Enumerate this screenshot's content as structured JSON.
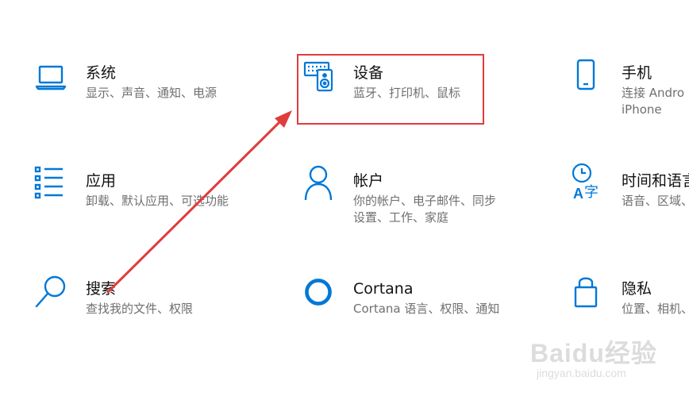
{
  "tiles": [
    {
      "title": "系统",
      "desc": "显示、声音、通知、电源",
      "icon": "laptop-icon"
    },
    {
      "title": "设备",
      "desc": "蓝牙、打印机、鼠标",
      "icon": "devices-icon"
    },
    {
      "title": "手机",
      "desc_line1": "连接 Andro",
      "desc_line2": "iPhone",
      "icon": "phone-icon"
    },
    {
      "title": "应用",
      "desc": "卸载、默认应用、可选功能",
      "icon": "apps-list-icon"
    },
    {
      "title": "帐户",
      "desc_line1": "你的帐户、电子邮件、同步",
      "desc_line2": "设置、工作、家庭",
      "icon": "person-icon"
    },
    {
      "title": "时间和语言",
      "desc": "语音、区域、",
      "icon": "time-language-icon"
    },
    {
      "title": "搜索",
      "desc": "查找我的文件、权限",
      "icon": "search-icon"
    },
    {
      "title": "Cortana",
      "desc": "Cortana 语言、权限、通知",
      "icon": "cortana-icon"
    },
    {
      "title": "隐私",
      "desc": "位置、相机、",
      "icon": "lock-icon"
    }
  ],
  "watermark": {
    "logo": "Baidu经验",
    "url": "jingyan.baidu.com"
  },
  "colors": {
    "accent": "#0078d7",
    "annotation": "#e03c3c",
    "title": "#111111",
    "desc": "#6f6f6f"
  }
}
